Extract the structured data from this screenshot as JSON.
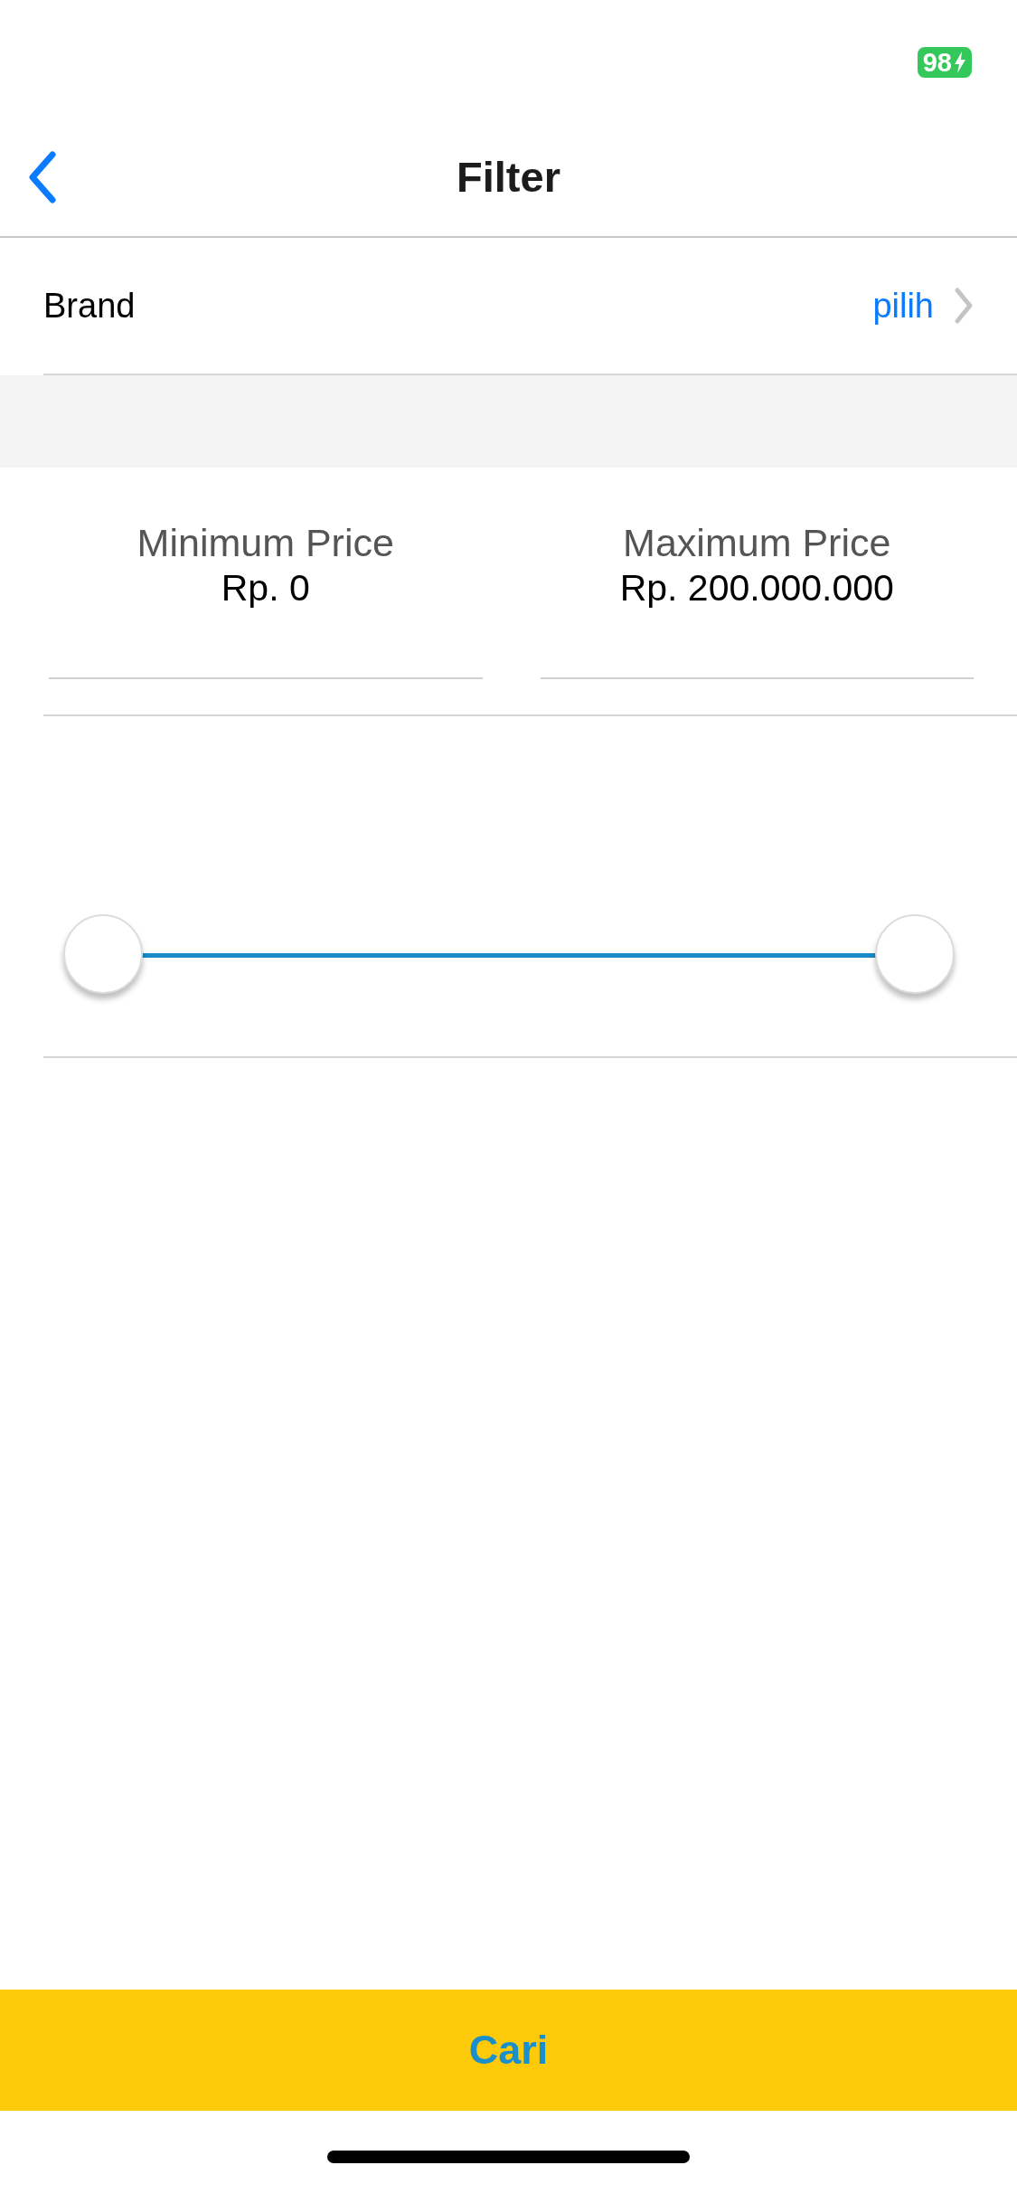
{
  "status_bar": {
    "battery": "98",
    "charging": true
  },
  "nav": {
    "title": "Filter"
  },
  "brand_row": {
    "label": "Brand",
    "value": "pilih"
  },
  "price": {
    "fields": [
      {
        "label": "Minimum Price",
        "value": "Rp. 0"
      },
      {
        "label": "Maximum Price",
        "value": "Rp. 200.000.000"
      }
    ]
  },
  "range_slider": {
    "thumbs": [
      {
        "level": 0
      },
      {
        "level": 1
      }
    ]
  },
  "submit_button": {
    "label": "Cari"
  }
}
